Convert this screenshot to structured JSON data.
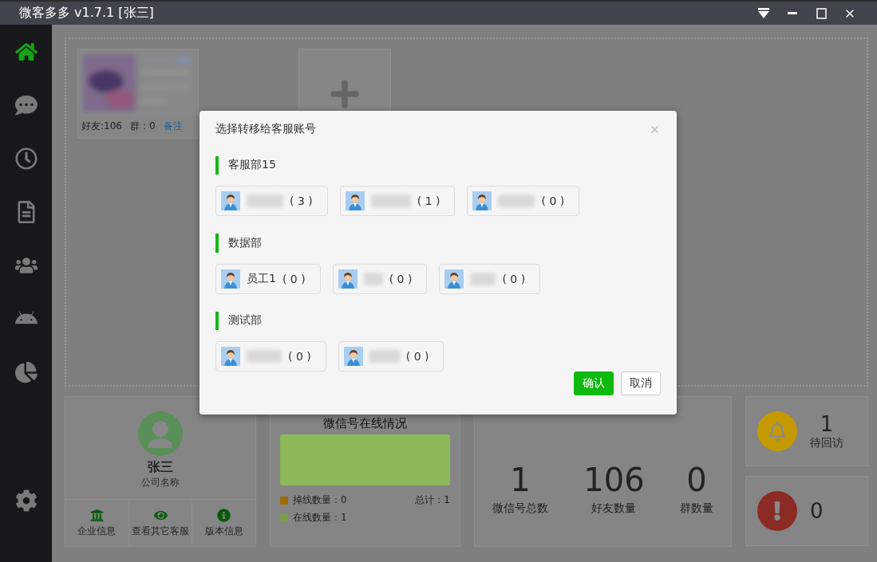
{
  "window": {
    "title": "微客多多 v1.7.1 [张三]"
  },
  "sidebar": {
    "items": [
      {
        "kind": "home",
        "selected": true
      },
      {
        "kind": "chat",
        "selected": false
      },
      {
        "kind": "clock",
        "selected": false
      },
      {
        "kind": "document",
        "selected": false
      },
      {
        "kind": "users",
        "selected": false
      },
      {
        "kind": "android",
        "selected": false
      },
      {
        "kind": "pie",
        "selected": false
      }
    ],
    "bottom_items": [
      {
        "kind": "settings",
        "selected": false
      }
    ]
  },
  "accounts": [
    {
      "kind": "picture",
      "friends": "好友:106",
      "groups": "群：0",
      "link": "备注"
    }
  ],
  "profile": {
    "name": "张三",
    "company": "公司名称",
    "actions": [
      {
        "kind": "bank",
        "label": "企业信息"
      },
      {
        "kind": "eye",
        "label": "查看其它客服"
      },
      {
        "kind": "info",
        "label": "版本信息"
      }
    ]
  },
  "online": {
    "title": "微信号在线情况",
    "legend": [
      {
        "label": "掉线数量：0",
        "color": "#a06c00"
      },
      {
        "label": "在线数量：1",
        "color": "#7a9e4c"
      }
    ],
    "total": "总计：1"
  },
  "stats": [
    {
      "value": "1",
      "label": "微信号总数"
    },
    {
      "value": "106",
      "label": "好友数量"
    },
    {
      "value": "0",
      "label": "群数量"
    }
  ],
  "alerts": [
    {
      "kind": "bell",
      "value": "1",
      "label": "待回访",
      "color": "#c49a00"
    },
    {
      "kind": "warning",
      "value": "0",
      "color": "#8c2a24"
    }
  ],
  "dialog": {
    "title": "选择转移给客服账号",
    "groups": [
      {
        "name": "客服部15",
        "agents": [
          {
            "blurred": true,
            "count": "( 3 )"
          },
          {
            "blurred": true,
            "count": "( 1 )"
          },
          {
            "blurred": true,
            "count": "( 0 )"
          }
        ]
      },
      {
        "name": "数据部",
        "agents": [
          {
            "blurred": false,
            "name": "员工1",
            "count": "( 0 )"
          },
          {
            "blurred": true,
            "count": "( 0 )"
          },
          {
            "blurred": true,
            "count": "( 0 )"
          }
        ]
      },
      {
        "name": "测试部",
        "agents": [
          {
            "blurred": true,
            "count": "( 0 )"
          },
          {
            "blurred": true,
            "count": "( 0 )"
          }
        ]
      }
    ],
    "buttons": [
      {
        "kind": "primary",
        "label": "确认"
      },
      {
        "kind": "secondary",
        "label": "取消"
      }
    ]
  }
}
